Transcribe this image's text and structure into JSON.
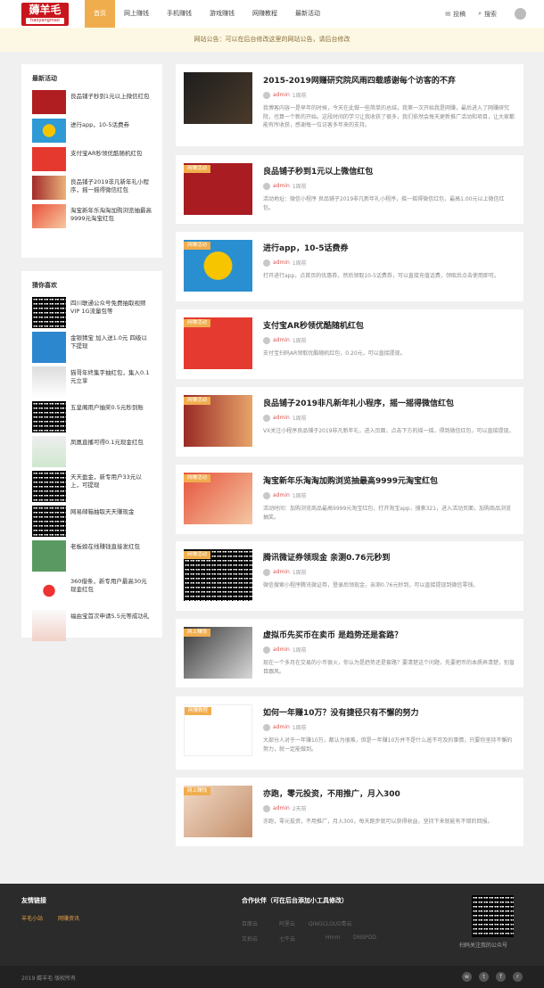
{
  "header": {
    "logo_main": "薅羊毛",
    "logo_sub": "haoyangmao",
    "nav": [
      "首页",
      "网上赚钱",
      "手机赚钱",
      "游戏赚钱",
      "网赚教程",
      "最新活动"
    ],
    "post_label": "投稿",
    "search_label": "搜索"
  },
  "notice": "网站公告：可以在后台修改这里的网站公告，请后台修改",
  "sidebar1": {
    "title": "最新活动",
    "items": [
      "良品铺子秒到1元以上微信红包",
      "进行app，10-5话费券",
      "支付宝AR秒领优酷随机红包",
      "良品铺子2019非凡新年礼小程序，摇一摇得微信红包",
      "淘宝新年乐淘淘加购浏览抽最高9999元淘宝红包"
    ]
  },
  "sidebar2": {
    "title": "猜你喜欢",
    "items": [
      "四川联通公众号免费抽取视频VIP 1G流量包等",
      "金银猜宝 加入送1.0元 四级以下提现",
      "猫哥年终集字抽红包，集入0.1元立享",
      "五皇阁用户抽奖0.5元秒到账",
      "凤凰直播可得0.1元现金红包",
      "天天盈金，新专用户33元以上，可提现",
      "网易邮箱抽取天天赚现金",
      "老板娘在线赚钱直接发红包",
      "360借条，新专用户最高30元现金红包",
      "福由宝首次申请5.5元等成功礼"
    ]
  },
  "posts": [
    {
      "tag": "",
      "title": "2015-2019网赚研究院风雨四载感谢每个访客的不弃",
      "author": "admin",
      "time": "1周前",
      "excerpt": "我博客内容一是早年的时候，今天在此做一些简单的总结，我第一次开始我是网赚，最后进入了网赚研究院，也算一个新的开始。这段时间的学习让我收获了很多，我们依然会每天更新推广活动和项目，让大家都能有所收获，感谢每一位访客多年来的支持。"
    },
    {
      "tag": "网赚活动",
      "title": "良品铺子秒到1元以上微信红包",
      "author": "admin",
      "time": "1周前",
      "excerpt": "活动地址：微信小程序 良品铺子2019非凡新年礼小程序，摇一摇得微信红包，最高1.00元以上微信红包。"
    },
    {
      "tag": "网赚活动",
      "title": "进行app，10-5话费券",
      "author": "admin",
      "time": "1周前",
      "excerpt": "打开进行app，点首页的优惠券，然后领取10-5话费券，可以直接充值话费，领取后点击使用即可。"
    },
    {
      "tag": "网赚活动",
      "title": "支付宝AR秒领优酷随机红包",
      "author": "admin",
      "time": "1周前",
      "excerpt": "支付宝扫码AR领取优酷随机红包，0.20元，可以直接提现。"
    },
    {
      "tag": "网赚活动",
      "title": "良品铺子2019非凡新年礼小程序，摇一摇得微信红包",
      "author": "admin",
      "time": "1周前",
      "excerpt": "VX关注小程序良品铺子2019非凡新年礼，进入页面，点击下方的摇一摇，得到微信红包，可以直接提现。"
    },
    {
      "tag": "网赚活动",
      "title": "淘宝新年乐淘淘加购浏览抽最高9999元淘宝红包",
      "author": "admin",
      "time": "1周前",
      "excerpt": "活动时间：加购浏览商品最高9999元淘宝红包，打开淘宝app，搜索321，进入活动页面，加购商品浏览抽奖。"
    },
    {
      "tag": "网赚活动",
      "title": "腾讯微证券领现金 亲测0.76元秒到",
      "author": "admin",
      "time": "1周前",
      "excerpt": "微信搜索小程序腾讯微证券，登录后领现金，亲测0.76元秒到，可以直接提现到微信零钱。"
    },
    {
      "tag": "网上赚钱",
      "title": "虚拟币先买币在卖币 是趋势还是套路？",
      "author": "admin",
      "time": "1周前",
      "excerpt": "现在一个多月在交易的小币很火，你认为是趋势还是套路？要清楚这个问题，先要把币的本质弄清楚，别盲目跟风。"
    },
    {
      "tag": "网赚教程",
      "title": "如何一年赚10万？没有捷径只有不懈的努力",
      "author": "admin",
      "time": "1周前",
      "excerpt": "大部分人对于一年赚10万，都认为很难，但是一年赚10万并不是什么遥不可及的事情，只要你坚持不懈的努力，就一定能做到。"
    },
    {
      "tag": "网上赚钱",
      "title": "亦跑，零元投资，不用推广，月入300",
      "author": "admin",
      "time": "2天前",
      "excerpt": "亦跑，零元投资，不用推广，月入300，每天跑步就可以获得收益，坚持下来就能有不错的回报。"
    }
  ],
  "footer": {
    "links_title": "友情链接",
    "links": [
      "羊毛小站",
      "网赚资讯"
    ],
    "partners_title": "合作伙伴（可在后台添加小工具修改）",
    "partners": [
      "百度云",
      "阿里云",
      "QINGCLOUD青云",
      "又拍云",
      "七牛云",
      "Hmm",
      "DNSPOD"
    ],
    "qr_label": "扫码关注我的公众号",
    "copyright": "2019 薅羊毛 版权所有"
  }
}
